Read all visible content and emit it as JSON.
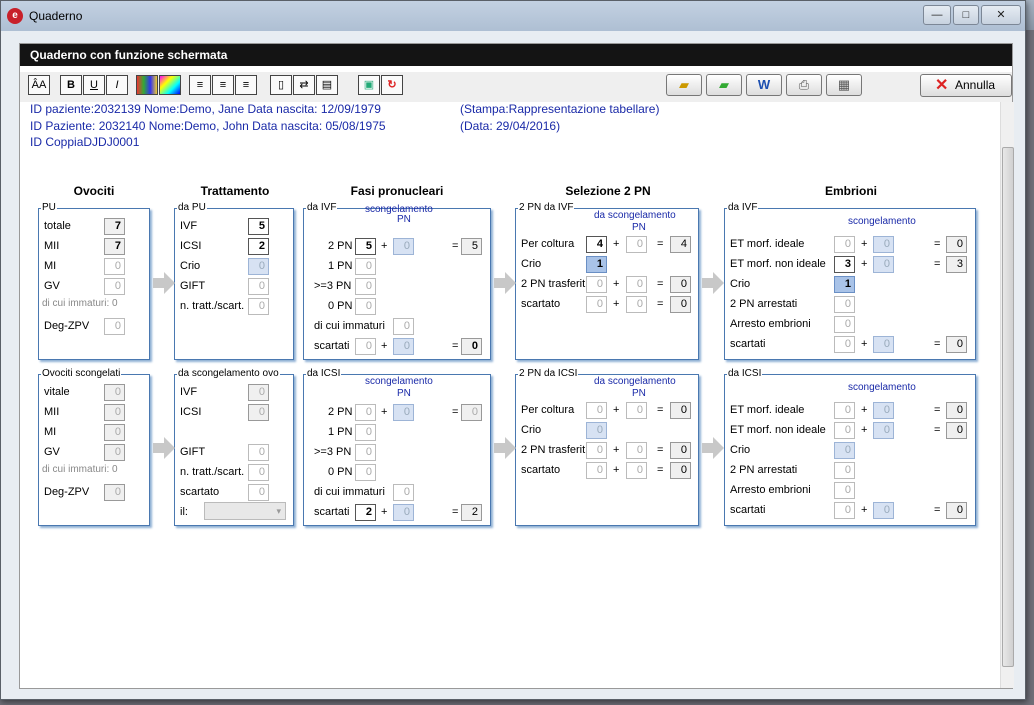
{
  "window": {
    "title": "Quaderno",
    "min": "—",
    "max": "□",
    "close": "✕"
  },
  "header": {
    "title": "Quaderno con funzione schermata"
  },
  "toolbar": {
    "font": "ÂA",
    "bold": "B",
    "underline": "U",
    "italic": "I",
    "annulla": "Annulla"
  },
  "info": {
    "line1": "ID paziente:2032139   Nome:Demo, Jane   Data nascita: 12/09/1979",
    "line1b": "(Stampa:Rappresentazione tabellare)",
    "line2": "ID Paziente: 2032140   Nome:Demo, John   Data nascita: 05/08/1975",
    "line2b": "(Data: 29/04/2016)",
    "line3": "ID CoppiaDJDJ0001"
  },
  "sections": {
    "ovociti": "Ovociti",
    "trattamento": "Trattamento",
    "fasi": "Fasi pronucleari",
    "selezione": "Selezione 2 PN",
    "embrioni": "Embrioni"
  },
  "ovociti_pu": {
    "legend": "PU",
    "rows": [
      {
        "label": "totale",
        "value": "7"
      },
      {
        "label": "MII",
        "value": "7"
      },
      {
        "label": "MI",
        "value": "0"
      },
      {
        "label": "GV",
        "value": "0"
      }
    ],
    "immaturi": "di cui immaturi: 0",
    "deg_label": "Deg-ZPV",
    "deg_value": "0"
  },
  "ovociti_scong": {
    "legend": "Ovociti scongelati",
    "rows": [
      {
        "label": "vitale",
        "value": "0"
      },
      {
        "label": "MII",
        "value": "0"
      },
      {
        "label": "MI",
        "value": "0"
      },
      {
        "label": "GV",
        "value": "0"
      }
    ],
    "immaturi": "di cui immaturi: 0",
    "deg_label": "Deg-ZPV",
    "deg_value": "0"
  },
  "tratt_pu": {
    "legend": "da PU",
    "rows": [
      {
        "label": "IVF",
        "value": "5"
      },
      {
        "label": "ICSI",
        "value": "2"
      },
      {
        "label": "Crio",
        "value": "0"
      },
      {
        "label": "GIFT",
        "value": "0"
      },
      {
        "label": "n. tratt./scart.",
        "value": "0"
      }
    ]
  },
  "tratt_scong": {
    "legend": "da scongelamento ovo",
    "rows": [
      {
        "label": "IVF",
        "value": "0"
      },
      {
        "label": "ICSI",
        "value": "0"
      },
      {
        "label": "GIFT",
        "value": "0"
      },
      {
        "label": "n. tratt./scart.",
        "value": "0"
      },
      {
        "label": "scartato",
        "value": "0"
      }
    ],
    "il": "il:"
  },
  "fasi_ivf": {
    "legend": "da IVF",
    "sub": "scongelamento",
    "sub2": "PN",
    "rows": [
      {
        "label": "2 PN",
        "a": "5",
        "b": "0",
        "t": "5"
      },
      {
        "label": "1 PN",
        "a": "0"
      },
      {
        "label": ">=3 PN",
        "a": "0"
      },
      {
        "label": "0 PN",
        "a": "0"
      }
    ],
    "imm_label": "di cui immaturi",
    "imm": "0",
    "scart_label": "scartati",
    "sa": "0",
    "sb": "0",
    "st": "0"
  },
  "fasi_icsi": {
    "legend": "da ICSI",
    "sub": "scongelamento",
    "sub2": "PN",
    "rows": [
      {
        "label": "2 PN",
        "a": "0",
        "b": "0",
        "t": "0"
      },
      {
        "label": "1 PN",
        "a": "0"
      },
      {
        "label": ">=3 PN",
        "a": "0"
      },
      {
        "label": "0 PN",
        "a": "0"
      }
    ],
    "imm_label": "di cui immaturi",
    "imm": "0",
    "scart_label": "scartati",
    "sa": "2",
    "sb": "0",
    "st": "2"
  },
  "sel_ivf": {
    "legend": "2 PN da IVF",
    "sub": "da scongelamento",
    "sub2": "PN",
    "rows": [
      {
        "label": "Per coltura",
        "a": "4",
        "b": "0",
        "t": "4"
      },
      {
        "label": "Crio",
        "a": "1"
      },
      {
        "label": "2 PN trasferit",
        "a": "0",
        "b": "0",
        "t": "0"
      },
      {
        "label": "scartato",
        "a": "0",
        "b": "0",
        "t": "0"
      }
    ]
  },
  "sel_icsi": {
    "legend": "2 PN da ICSI",
    "sub": "da scongelamento",
    "sub2": "PN",
    "rows": [
      {
        "label": "Per coltura",
        "a": "0",
        "b": "0",
        "t": "0"
      },
      {
        "label": "Crio",
        "a": "0"
      },
      {
        "label": "2 PN trasferit",
        "a": "0",
        "b": "0",
        "t": "0"
      },
      {
        "label": "scartato",
        "a": "0",
        "b": "0",
        "t": "0"
      }
    ]
  },
  "emb_ivf": {
    "legend": "da IVF",
    "sub": "scongelamento",
    "rows": [
      {
        "label": "ET morf. ideale",
        "a": "0",
        "b": "0",
        "t": "0"
      },
      {
        "label": "ET morf. non ideale",
        "a": "3",
        "b": "0",
        "t": "3"
      },
      {
        "label": "Crio",
        "a": "1"
      },
      {
        "label": "2 PN arrestati",
        "a": "0"
      },
      {
        "label": "Arresto embrioni",
        "a": "0"
      },
      {
        "label": "scartati",
        "a": "0",
        "b": "0",
        "t": "0"
      }
    ]
  },
  "emb_icsi": {
    "legend": "da ICSI",
    "sub": "scongelamento",
    "rows": [
      {
        "label": "ET morf. ideale",
        "a": "0",
        "b": "0",
        "t": "0"
      },
      {
        "label": "ET morf. non ideale",
        "a": "0",
        "b": "0",
        "t": "0"
      },
      {
        "label": "Crio",
        "a": "0"
      },
      {
        "label": "2 PN arrestati",
        "a": "0"
      },
      {
        "label": "Arresto embrioni",
        "a": "0"
      },
      {
        "label": "scartati",
        "a": "0",
        "b": "0",
        "t": "0"
      }
    ]
  },
  "symbols": {
    "plus": "+",
    "eq": "="
  }
}
